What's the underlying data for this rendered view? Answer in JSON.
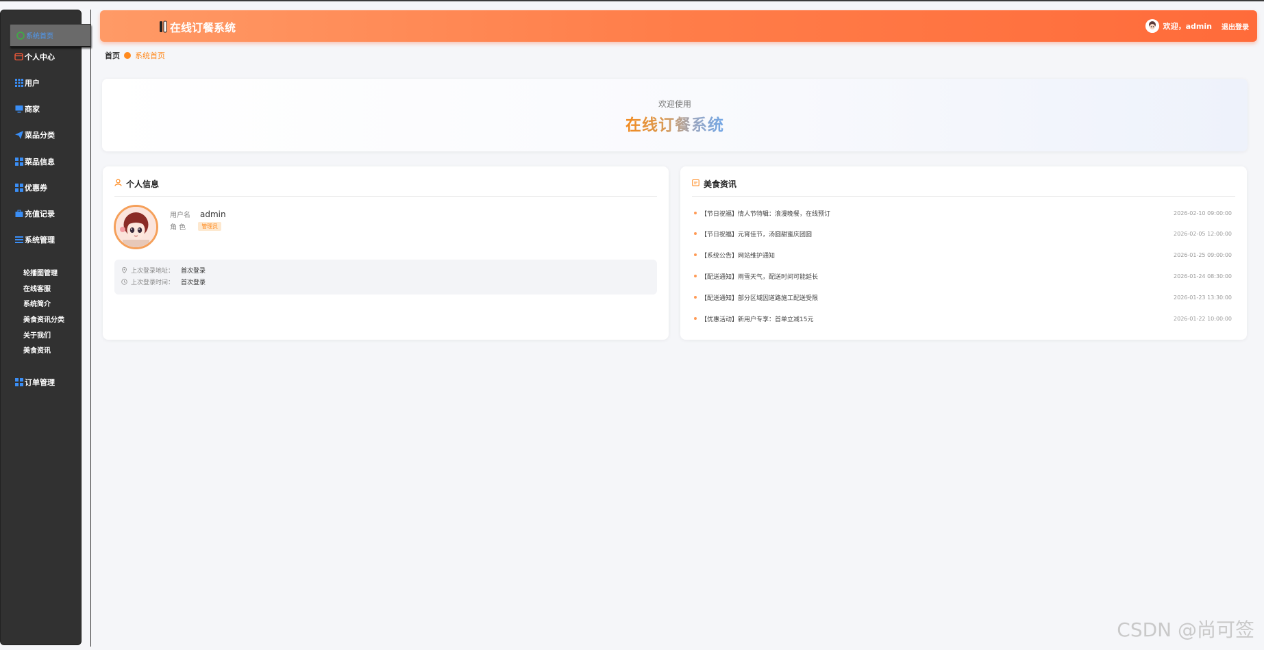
{
  "app": {
    "title": "在线订餐系统"
  },
  "header": {
    "welcome_text": "欢迎，admin",
    "logout_label": "退出登录"
  },
  "sidebar": {
    "items": [
      {
        "label": "系统首页",
        "icon": "home-icon"
      },
      {
        "label": "个人中心",
        "icon": "wallet-icon"
      },
      {
        "label": "用户",
        "icon": "grid-icon"
      },
      {
        "label": "商家",
        "icon": "monitor-icon"
      },
      {
        "label": "菜品分类",
        "icon": "paper-plane-icon"
      },
      {
        "label": "菜品信息",
        "icon": "grid-icon"
      },
      {
        "label": "优惠券",
        "icon": "grid-icon"
      },
      {
        "label": "充值记录",
        "icon": "briefcase-icon"
      },
      {
        "label": "系统管理",
        "icon": "list-icon"
      },
      {
        "label": "订单管理",
        "icon": "grid-icon"
      }
    ],
    "sub_items": [
      "轮播图管理",
      "在线客服",
      "系统简介",
      "美食资讯分类",
      "关于我们",
      "美食资讯"
    ]
  },
  "breadcrumb": {
    "home": "首页",
    "current": "系统首页"
  },
  "welcome": {
    "sub": "欢迎使用",
    "title": "在线订餐系统"
  },
  "profile": {
    "title": "个人信息",
    "username_label": "用户名",
    "username": "admin",
    "role_label": "角 色",
    "role": "管理员",
    "last_login_addr_label": "上次登录地址：",
    "last_login_addr": "首次登录",
    "last_login_time_label": "上次登录时间：",
    "last_login_time": "首次登录"
  },
  "news": {
    "title": "美食资讯",
    "items": [
      {
        "text": "【节日祝福】情人节特辑：浪漫晚餐，在线预订",
        "time": "2026-02-10 09:00:00"
      },
      {
        "text": "【节日祝福】元宵佳节，汤圆甜蜜庆团圆",
        "time": "2026-02-05 12:00:00"
      },
      {
        "text": "【系统公告】网站维护通知",
        "time": "2026-01-25 09:00:00"
      },
      {
        "text": "【配送通知】雨雪天气，配送时间可能延长",
        "time": "2026-01-24 08:30:00"
      },
      {
        "text": "【配送通知】部分区域因道路施工配送受限",
        "time": "2026-01-23 13:30:00"
      },
      {
        "text": "【优惠活动】新用户专享：首单立减15元",
        "time": "2026-01-22 10:00:00"
      }
    ]
  },
  "watermark": "CSDN @尚可签"
}
